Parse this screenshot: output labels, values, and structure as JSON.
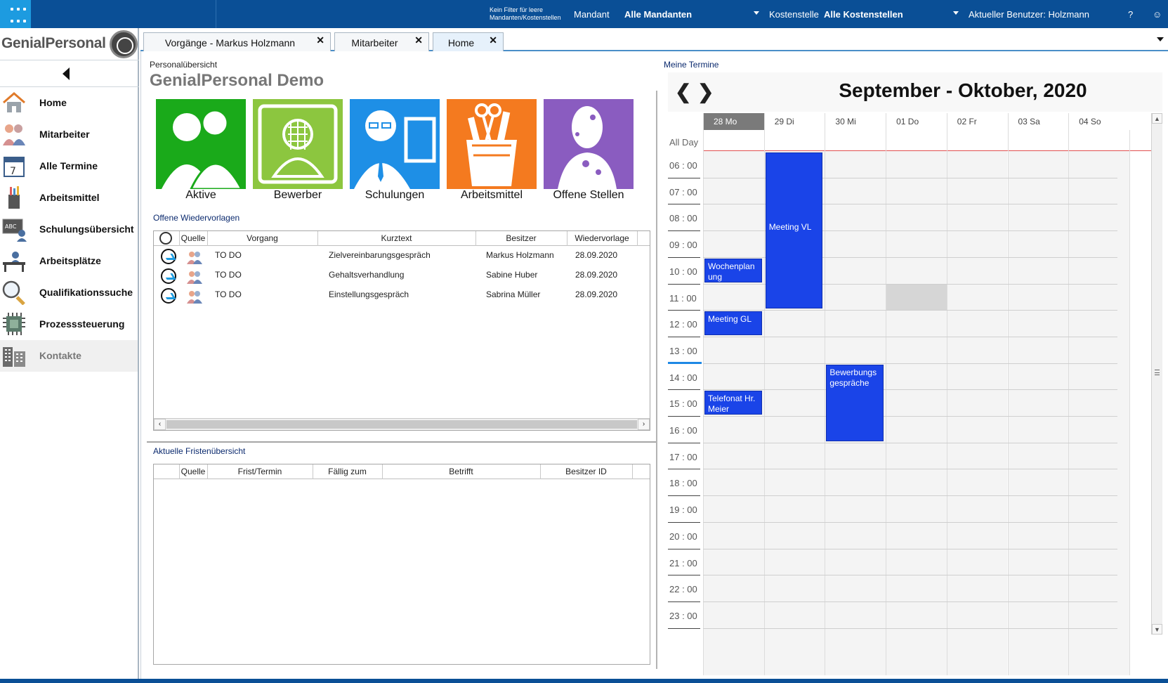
{
  "topbar": {
    "filter_hint_line1": "Kein Filter für leere",
    "filter_hint_line2": "Mandanten/Kostenstellen",
    "mandant_label": "Mandant",
    "mandant_value": "Alle Mandanten",
    "kostenstelle_label": "Kostenstelle",
    "kostenstelle_value": "Alle Kostenstellen",
    "user_label": "Aktueller Benutzer: Holzmann",
    "help": "?",
    "accent": "#0a4f96"
  },
  "sidebar": {
    "brand": "GenialPersonal",
    "items": [
      {
        "label": "Home",
        "icon": "home-icon"
      },
      {
        "label": "Mitarbeiter",
        "icon": "people-icon"
      },
      {
        "label": "Alle Termine",
        "icon": "calendar-icon"
      },
      {
        "label": "Arbeitsmittel",
        "icon": "tools-cup-icon"
      },
      {
        "label": "Schulungsübersicht",
        "icon": "blackboard-icon"
      },
      {
        "label": "Arbeitsplätze",
        "icon": "desk-icon"
      },
      {
        "label": "Qualifikationssuche",
        "icon": "magnifier-icon"
      },
      {
        "label": "Prozesssteuerung",
        "icon": "chip-icon"
      },
      {
        "label": "Kontakte",
        "icon": "building-icon",
        "disabled": true
      }
    ]
  },
  "tabs": [
    {
      "label": "Vorgänge - Markus Holzmann",
      "close": "✕"
    },
    {
      "label": "Mitarbeiter",
      "close": "✕"
    },
    {
      "label": "Home",
      "close": "✕",
      "active": true
    }
  ],
  "main": {
    "breadcrumb": "Personalübersicht",
    "title": "GenialPersonal Demo",
    "tiles": [
      {
        "label": "Aktive",
        "color": "#1aaa1a"
      },
      {
        "label": "Bewerber",
        "color": "#8cc63f"
      },
      {
        "label": "Schulungen",
        "color": "#1e8fe6"
      },
      {
        "label": "Arbeitsmittel",
        "color": "#f47a1f"
      },
      {
        "label": "Offene Stellen",
        "color": "#8a5cc0"
      }
    ],
    "wiedervorlagen": {
      "title": "Offene Wiedervorlagen",
      "columns": [
        "Quelle",
        "Vorgang",
        "Kurztext",
        "Besitzer",
        "Wiedervorlage"
      ],
      "rows": [
        {
          "vorgang": "TO DO",
          "kurztext": "Zielvereinbarungsgespräch",
          "besitzer": "Markus Holzmann",
          "datum": "28.09.2020"
        },
        {
          "vorgang": "TO DO",
          "kurztext": "Gehaltsverhandlung",
          "besitzer": "Sabine Huber",
          "datum": "28.09.2020"
        },
        {
          "vorgang": "TO DO",
          "kurztext": "Einstellungsgespräch",
          "besitzer": "Sabrina Müller",
          "datum": "28.09.2020"
        }
      ]
    },
    "fristen": {
      "title": "Aktuelle Fristenübersicht",
      "columns": [
        "Quelle",
        "Frist/Termin",
        "Fällig zum",
        "Betrifft",
        "Besitzer ID"
      ]
    }
  },
  "calendar": {
    "title": "Meine Termine",
    "range": "September - Oktober, 2020",
    "prev": "❮",
    "next": "❯",
    "allday_label": "All Day",
    "days": [
      "28 Mo",
      "29 Di",
      "30 Mi",
      "01 Do",
      "02 Fr",
      "03 Sa",
      "04 So"
    ],
    "hours": [
      "06 : 00",
      "07 : 00",
      "08 : 00",
      "09 : 00",
      "10 : 00",
      "11 : 00",
      "12 : 00",
      "13 : 00",
      "14 : 00",
      "15 : 00",
      "16 : 00",
      "17 : 00",
      "18 : 00",
      "19 : 00",
      "20 : 00",
      "21 : 00",
      "22 : 00",
      "23 : 00"
    ],
    "events": [
      {
        "title": "Meeting VL",
        "day": 1,
        "start": 6,
        "end": 11.9
      },
      {
        "title": "Wochenplanung",
        "day": 0,
        "start": 10,
        "end": 10.9
      },
      {
        "title": "Meeting GL",
        "day": 0,
        "start": 12,
        "end": 12.9
      },
      {
        "title": "Bewerbungsgespräche",
        "day": 2,
        "start": 14,
        "end": 16.9
      },
      {
        "title": "Telefonat Hr. Meier",
        "day": 0,
        "start": 15,
        "end": 15.9
      }
    ],
    "event_color": "#1a44e8"
  }
}
